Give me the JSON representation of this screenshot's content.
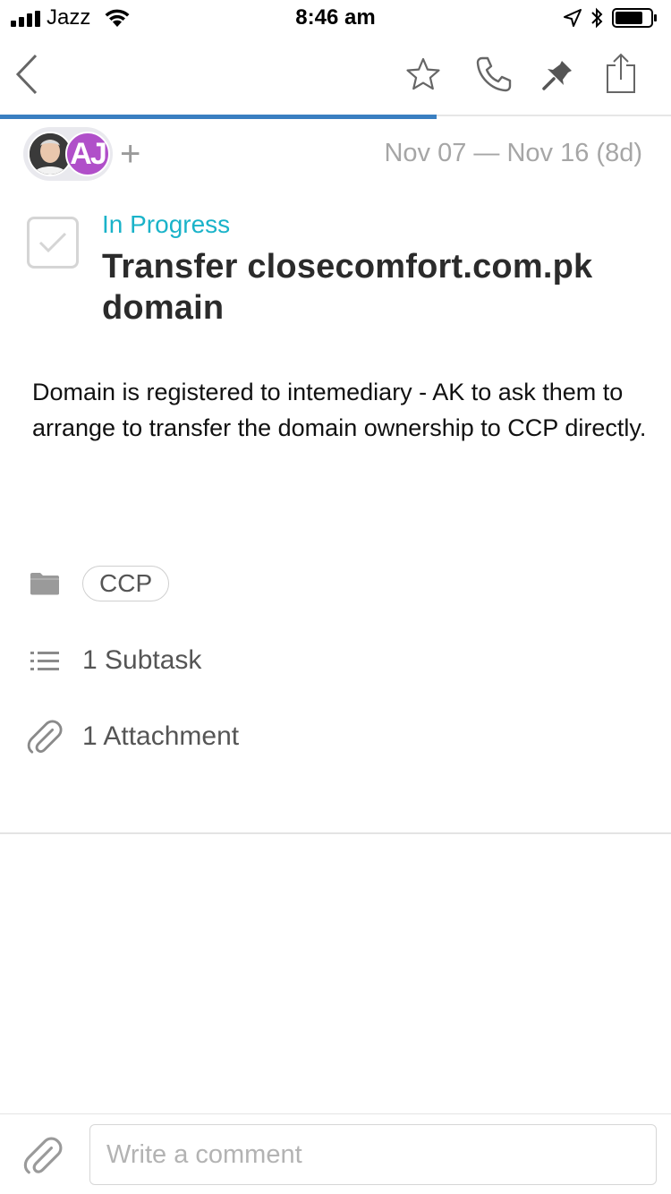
{
  "status_bar": {
    "carrier": "Jazz",
    "time": "8:46 am"
  },
  "nav": {
    "icons": [
      "back-icon",
      "star-icon",
      "phone-icon",
      "pin-icon",
      "share-icon"
    ],
    "progress_fraction": 0.65
  },
  "task": {
    "assignees": [
      {
        "kind": "photo"
      },
      {
        "initials": "AJ",
        "color": "#b04fc9"
      }
    ],
    "add_symbol": "+",
    "dates": "Nov 07 — Nov 16 (8d)",
    "status": "In Progress",
    "status_color": "#1ab3c9",
    "title": "Transfer closecomfort.com.pk domain",
    "description": "Domain is registered to intemediary - AK to ask them to arrange to transfer the domain ownership to CCP directly.",
    "project_tag": "CCP",
    "subtasks": "1 Subtask",
    "attachments": "1 Attachment"
  },
  "comment": {
    "placeholder": "Write a comment"
  },
  "colors": {
    "accent": "#3a7fc1",
    "muted": "#a6a6a6"
  }
}
